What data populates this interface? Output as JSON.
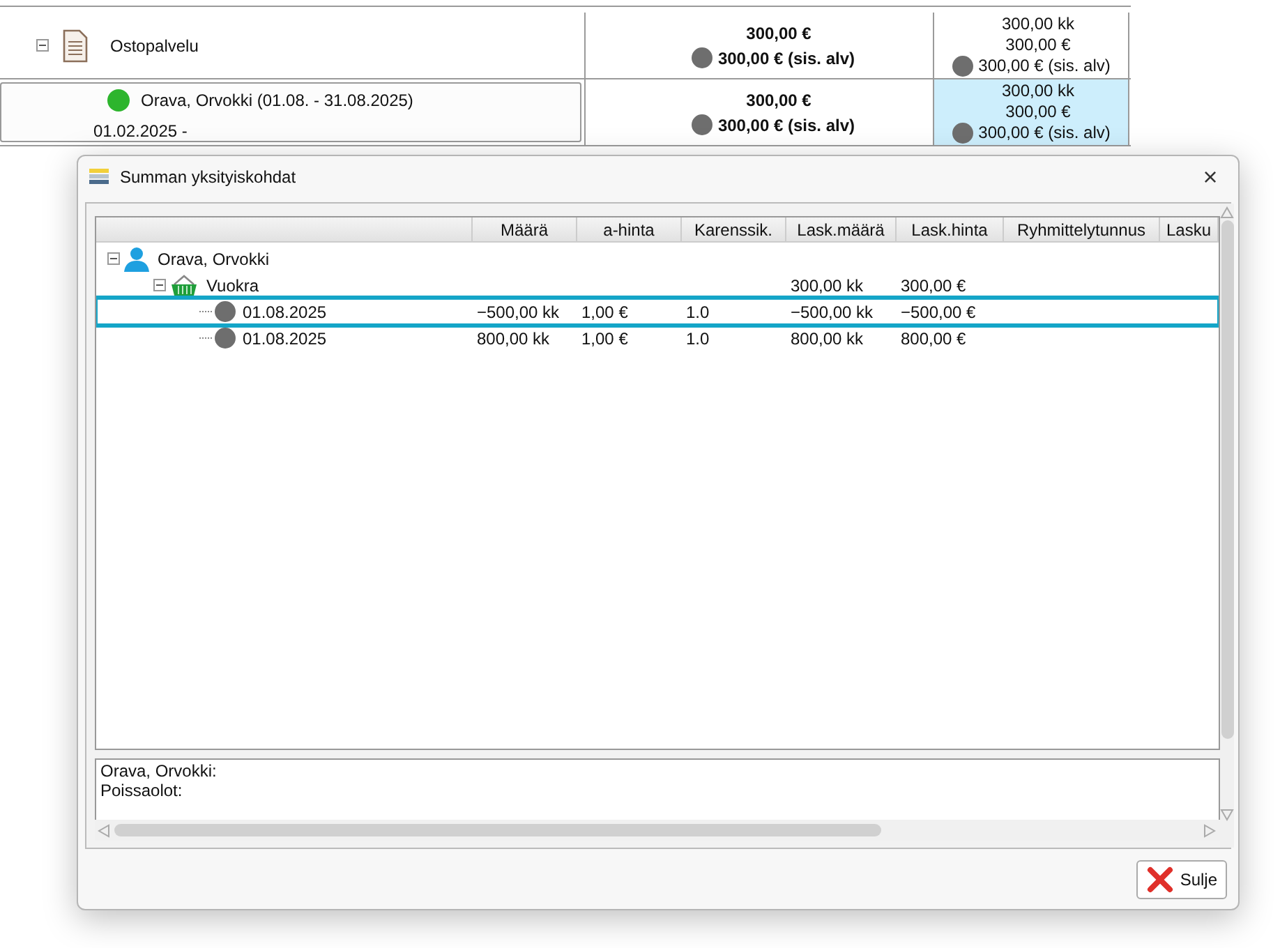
{
  "background_table": {
    "rows": [
      {
        "kind": "service",
        "label": "Ostopalvelu",
        "expanded": true,
        "amount": "300,00 €",
        "amount_vat": "300,00 € (sis. alv)",
        "detail": [
          "300,00 kk",
          "300,00 €"
        ],
        "detail_vat": "300,00 € (sis. alv)",
        "selected": false
      },
      {
        "kind": "person",
        "label": "Orava, Orvokki (01.08. - 31.08.2025)",
        "color": "#2db52d",
        "sublabel": "01.02.2025 -",
        "amount": "300,00 €",
        "amount_vat": "300,00 € (sis. alv)",
        "detail": [
          "300,00 kk",
          "300,00 €"
        ],
        "detail_vat": "300,00 € (sis. alv)",
        "selected": true
      }
    ]
  },
  "dialog": {
    "title": "Summan yksityiskohdat",
    "close": "×",
    "columns": [
      "Määrä",
      "a-hinta",
      "Karenssik.",
      "Lask.määrä",
      "Lask.hinta",
      "Ryhmittelytunnus",
      "Lasku"
    ],
    "tree": [
      {
        "kind": "person",
        "label": "Orava, Orvokki",
        "expanded": true,
        "selected": false,
        "children": [
          {
            "kind": "group",
            "label": "Vuokra",
            "expanded": true,
            "selected": false,
            "lask_maara": "300,00 kk",
            "lask_hinta": "300,00 €",
            "children": [
              {
                "kind": "entry",
                "label": "01.08.2025",
                "selected": true,
                "maara": "−500,00 kk",
                "a_hinta": "1,00 €",
                "karenssik": "1.0",
                "lask_maara": "−500,00 kk",
                "lask_hinta": "−500,00 €"
              },
              {
                "kind": "entry",
                "label": "01.08.2025",
                "selected": false,
                "maara": "800,00 kk",
                "a_hinta": "1,00 €",
                "karenssik": "1.0",
                "lask_maara": "800,00 kk",
                "lask_hinta": "800,00 €"
              }
            ]
          }
        ]
      }
    ],
    "info_lines": [
      "Orava, Orvokki:",
      "Poissaolot:"
    ],
    "close_button": "Sulje"
  }
}
